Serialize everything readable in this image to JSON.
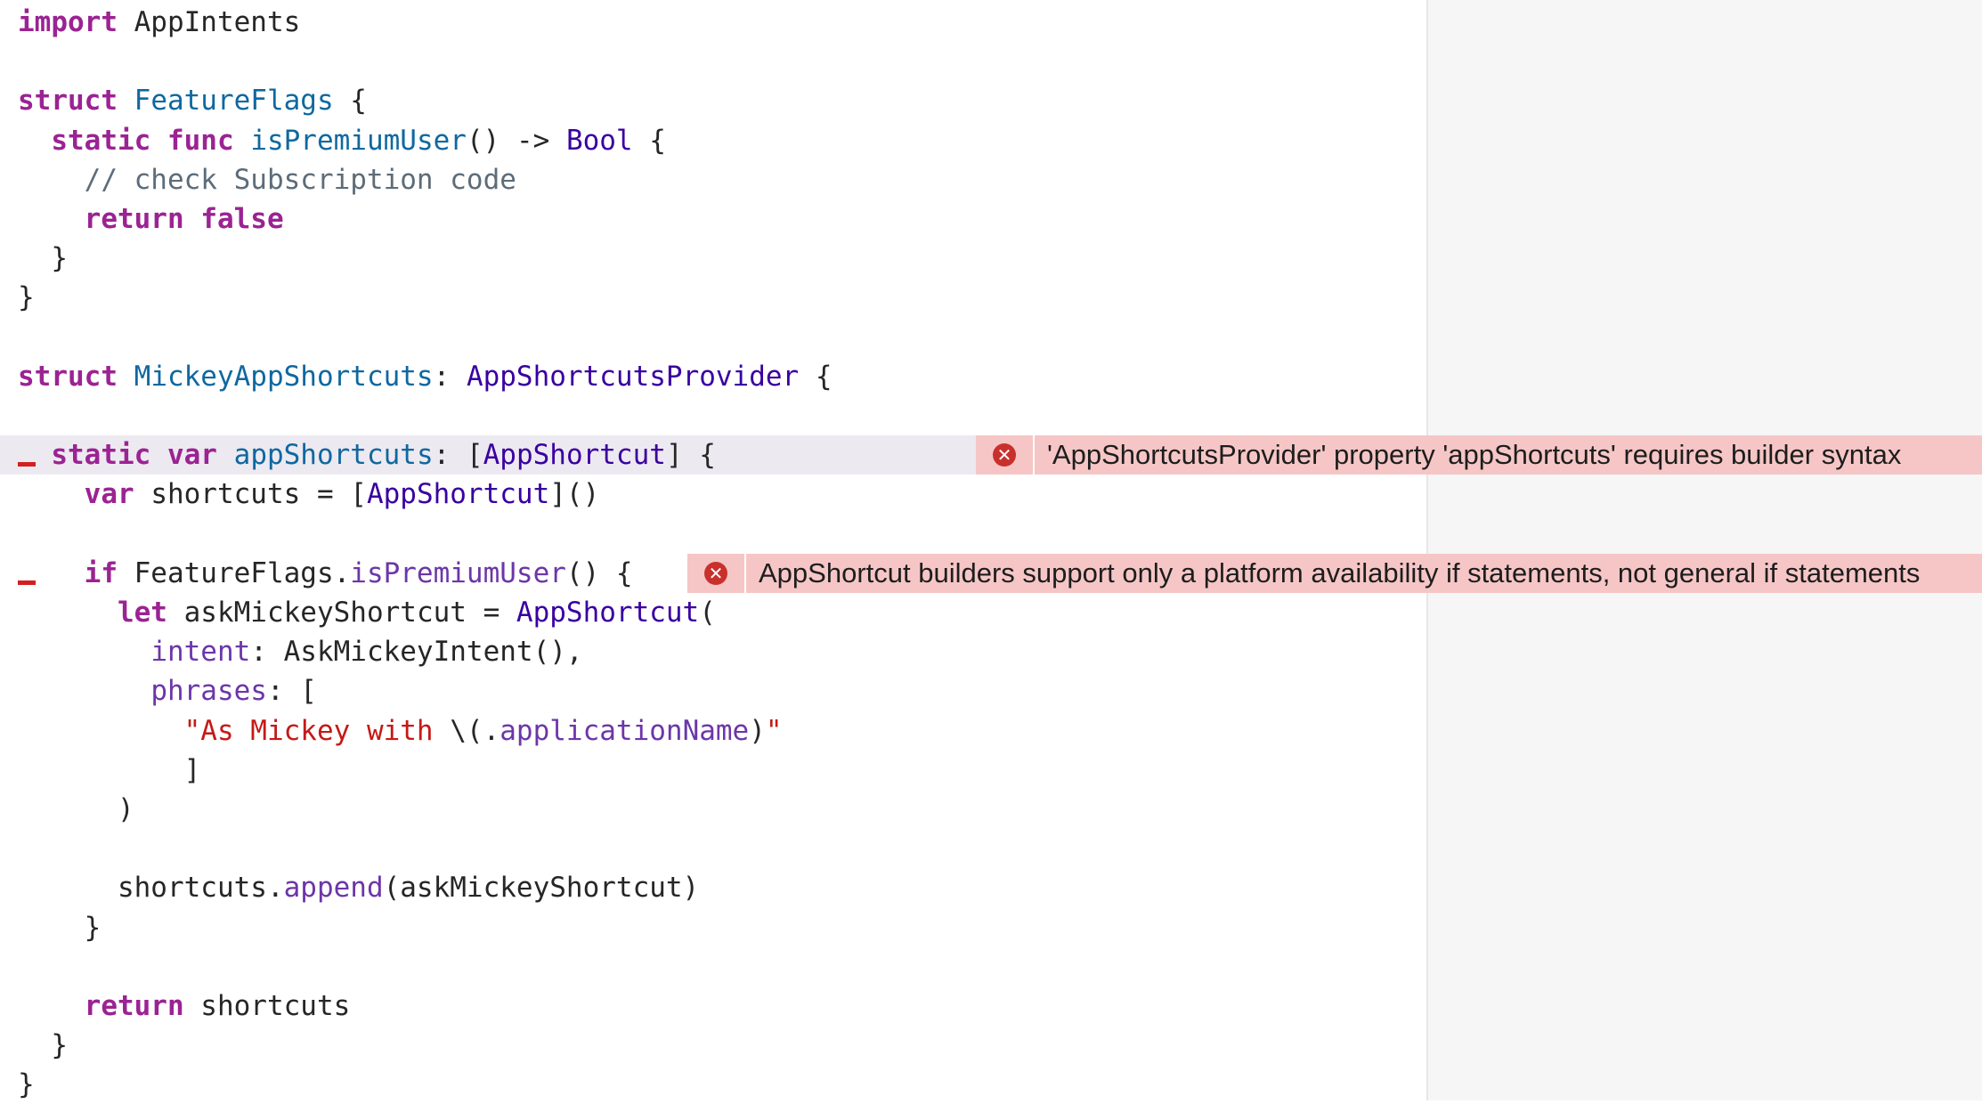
{
  "editor": {
    "lines": [
      [
        {
          "t": "kw",
          "v": "import"
        },
        {
          "t": "plain",
          "v": " AppIntents"
        }
      ],
      [],
      [
        {
          "t": "kw",
          "v": "struct"
        },
        {
          "t": "plain",
          "v": " "
        },
        {
          "t": "decl",
          "v": "FeatureFlags"
        },
        {
          "t": "plain",
          "v": " {"
        }
      ],
      [
        {
          "t": "plain",
          "v": "  "
        },
        {
          "t": "kw",
          "v": "static"
        },
        {
          "t": "plain",
          "v": " "
        },
        {
          "t": "kw",
          "v": "func"
        },
        {
          "t": "plain",
          "v": " "
        },
        {
          "t": "decl",
          "v": "isPremiumUser"
        },
        {
          "t": "plain",
          "v": "() -> "
        },
        {
          "t": "type",
          "v": "Bool"
        },
        {
          "t": "plain",
          "v": " {"
        }
      ],
      [
        {
          "t": "plain",
          "v": "    "
        },
        {
          "t": "com",
          "v": "// check Subscription code"
        }
      ],
      [
        {
          "t": "plain",
          "v": "    "
        },
        {
          "t": "kw",
          "v": "return"
        },
        {
          "t": "plain",
          "v": " "
        },
        {
          "t": "kw",
          "v": "false"
        }
      ],
      [
        {
          "t": "plain",
          "v": "  }"
        }
      ],
      [
        {
          "t": "plain",
          "v": "}"
        }
      ],
      [],
      [
        {
          "t": "kw",
          "v": "struct"
        },
        {
          "t": "plain",
          "v": " "
        },
        {
          "t": "decl",
          "v": "MickeyAppShortcuts"
        },
        {
          "t": "plain",
          "v": ": "
        },
        {
          "t": "type",
          "v": "AppShortcutsProvider"
        },
        {
          "t": "plain",
          "v": " {"
        }
      ],
      [],
      [
        {
          "t": "plain",
          "v": "  "
        },
        {
          "t": "kw",
          "v": "static"
        },
        {
          "t": "plain",
          "v": " "
        },
        {
          "t": "kw",
          "v": "var"
        },
        {
          "t": "plain",
          "v": " "
        },
        {
          "t": "decl",
          "v": "appShortcuts"
        },
        {
          "t": "plain",
          "v": ": ["
        },
        {
          "t": "type",
          "v": "AppShortcut"
        },
        {
          "t": "plain",
          "v": "] {"
        }
      ],
      [
        {
          "t": "plain",
          "v": "    "
        },
        {
          "t": "kw",
          "v": "var"
        },
        {
          "t": "plain",
          "v": " shortcuts = ["
        },
        {
          "t": "type",
          "v": "AppShortcut"
        },
        {
          "t": "plain",
          "v": "]()"
        }
      ],
      [],
      [
        {
          "t": "plain",
          "v": "    "
        },
        {
          "t": "kw",
          "v": "if"
        },
        {
          "t": "plain",
          "v": " FeatureFlags."
        },
        {
          "t": "member",
          "v": "isPremiumUser"
        },
        {
          "t": "plain",
          "v": "() {"
        }
      ],
      [
        {
          "t": "plain",
          "v": "      "
        },
        {
          "t": "kw",
          "v": "let"
        },
        {
          "t": "plain",
          "v": " askMickeyShortcut = "
        },
        {
          "t": "type",
          "v": "AppShortcut"
        },
        {
          "t": "plain",
          "v": "("
        }
      ],
      [
        {
          "t": "plain",
          "v": "        "
        },
        {
          "t": "member",
          "v": "intent"
        },
        {
          "t": "plain",
          "v": ": AskMickeyIntent(),"
        }
      ],
      [
        {
          "t": "plain",
          "v": "        "
        },
        {
          "t": "member",
          "v": "phrases"
        },
        {
          "t": "plain",
          "v": ": ["
        }
      ],
      [
        {
          "t": "plain",
          "v": "          "
        },
        {
          "t": "str",
          "v": "\"As Mickey with "
        },
        {
          "t": "plain",
          "v": "\\(."
        },
        {
          "t": "member",
          "v": "applicationName"
        },
        {
          "t": "plain",
          "v": ")"
        },
        {
          "t": "str",
          "v": "\""
        }
      ],
      [
        {
          "t": "plain",
          "v": "          ]"
        }
      ],
      [
        {
          "t": "plain",
          "v": "      )"
        }
      ],
      [],
      [
        {
          "t": "plain",
          "v": "      shortcuts."
        },
        {
          "t": "member",
          "v": "append"
        },
        {
          "t": "plain",
          "v": "(askMickeyShortcut)"
        }
      ],
      [
        {
          "t": "plain",
          "v": "    }"
        }
      ],
      [],
      [
        {
          "t": "plain",
          "v": "    "
        },
        {
          "t": "kw",
          "v": "return"
        },
        {
          "t": "plain",
          "v": " shortcuts"
        }
      ],
      [
        {
          "t": "plain",
          "v": "  }"
        }
      ],
      [
        {
          "t": "plain",
          "v": "}"
        }
      ]
    ],
    "errors": [
      {
        "line": 11,
        "message": "'AppShortcutsProvider' property 'appShortcuts' requires builder syntax",
        "highlight": true
      },
      {
        "line": 14,
        "message": "AppShortcut builders support only a platform availability if statements, not general if statements",
        "highlight": false
      }
    ],
    "error_icon": "xmark-circle-icon",
    "error_glyph": "✕"
  },
  "colors": {
    "keyword": "#9b2393",
    "type": "#3900a0",
    "declaration": "#0f68a0",
    "member": "#6c36a9",
    "comment": "#5d6c79",
    "string": "#c41a16",
    "error_bar": "#f6c6c6",
    "error_icon": "#c9302c"
  }
}
